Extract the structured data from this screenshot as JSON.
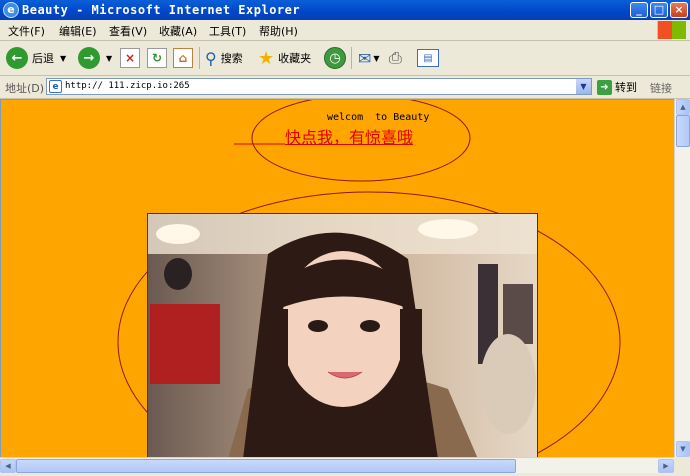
{
  "window": {
    "title": "Beauty - Microsoft Internet Explorer",
    "min_label": "_",
    "max_label": "□",
    "close_label": "×"
  },
  "menu": [
    "文件(F)",
    "编辑(E)",
    "查看(V)",
    "收藏(A)",
    "工具(T)",
    "帮助(H)"
  ],
  "toolbar": {
    "back_label": "后退",
    "search_label": "搜索",
    "favorites_label": "收藏夹"
  },
  "address": {
    "label": "地址(D)",
    "url": "http://      111.zicp.io:265",
    "go_label": "转到",
    "links_label": "链接"
  },
  "page": {
    "welcome_text": "welcom  to Beauty",
    "link_text": "快点我，有惊喜哦",
    "background": "#ffa500",
    "link_color": "#e00000",
    "ellipse_color": "#8b1a1a"
  }
}
